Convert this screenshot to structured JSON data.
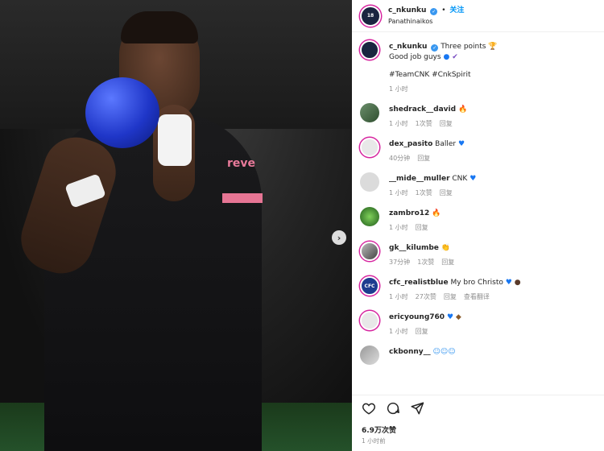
{
  "header": {
    "username": "c_nkunku",
    "follow_label": "关注",
    "location": "Panathinaikos",
    "avatar_text": "18"
  },
  "caption": {
    "username": "c_nkunku",
    "line1": "Three points",
    "line2": "Good job guys",
    "tags": "#TeamCNK #CnkSpirit",
    "time": "1 小时"
  },
  "comments": [
    {
      "username": "shedrack__david",
      "text": "",
      "emoji": "fire-emoji",
      "time": "1 小时",
      "likes": "1次赞",
      "reply": "回复"
    },
    {
      "username": "dex_pasito",
      "text": "Baller",
      "emoji": "blue-heart-emoji",
      "time": "40分钟",
      "likes": "",
      "reply": "回复"
    },
    {
      "username": "__mide__muller",
      "text": "CNK",
      "emoji": "blue-heart-emoji",
      "time": "1 小时",
      "likes": "1次赞",
      "reply": "回复"
    },
    {
      "username": "zambro12",
      "text": "",
      "emoji": "fire-emoji",
      "time": "1 小时",
      "likes": "",
      "reply": "回复"
    },
    {
      "username": "gk__kilumbe",
      "text": "",
      "emoji": "clap-emoji",
      "time": "37分钟",
      "likes": "1次赞",
      "reply": "回复"
    },
    {
      "username": "cfc_realistblue",
      "text": "My bro Christo",
      "emoji": "blue-heart-emoji",
      "time": "1 小时",
      "likes": "27次赞",
      "reply": "回复",
      "translate": "查看翻译"
    },
    {
      "username": "ericyoung760",
      "text": "",
      "emoji": "blue-heart-emoji",
      "time": "1 小时",
      "likes": "",
      "reply": "回复"
    },
    {
      "username": "ckbonny__",
      "text": "",
      "emoji": "smile-emoji",
      "time": "",
      "likes": "",
      "reply": ""
    }
  ],
  "footer": {
    "likes": "6.9万次赞",
    "time": "1 小时前"
  },
  "photo": {
    "sponsor_text": "reve"
  }
}
